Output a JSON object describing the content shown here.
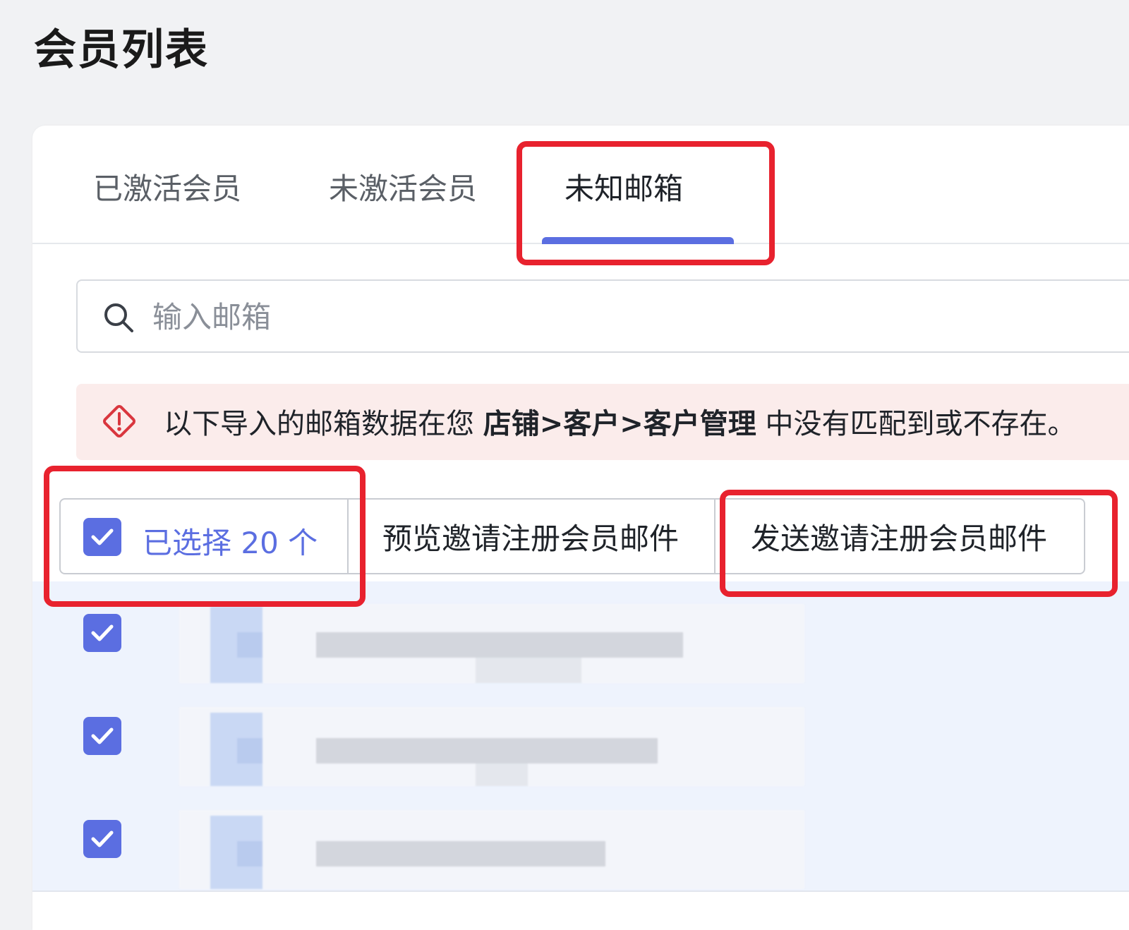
{
  "page": {
    "title": "会员列表"
  },
  "tabs": [
    {
      "label": "已激活会员",
      "active": false
    },
    {
      "label": "未激活会员",
      "active": false
    },
    {
      "label": "未知邮箱",
      "active": true
    }
  ],
  "search": {
    "placeholder": "输入邮箱",
    "value": ""
  },
  "alert": {
    "prefix": "以下导入的邮箱数据在您 ",
    "path": "店铺>客户>客户管理",
    "suffix": " 中没有匹配到或不存在。"
  },
  "bulk": {
    "selected_label": "已选择 20 个",
    "preview_label": "预览邀请注册会员邮件",
    "send_label": "发送邀请注册会员邮件"
  },
  "rows": [
    {
      "checked": true,
      "email": ""
    },
    {
      "checked": true,
      "email": ""
    },
    {
      "checked": true,
      "email": ""
    }
  ],
  "colors": {
    "accent": "#5b6ee1",
    "highlight": "#e8222e",
    "alert_bg": "#fbeceb",
    "alert_icon": "#d9363e"
  }
}
